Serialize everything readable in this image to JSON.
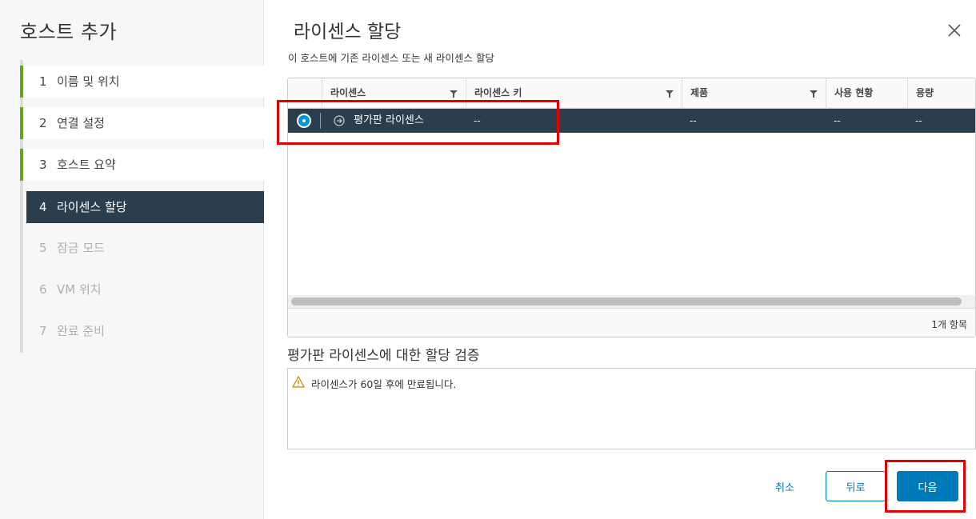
{
  "wizard": {
    "title": "호스트 추가",
    "steps": [
      {
        "num": "1",
        "label": "이름 및 위치",
        "state": "done"
      },
      {
        "num": "2",
        "label": "연결 설정",
        "state": "done"
      },
      {
        "num": "3",
        "label": "호스트 요약",
        "state": "done"
      },
      {
        "num": "4",
        "label": "라이센스 할당",
        "state": "active"
      },
      {
        "num": "5",
        "label": "잠금 모드",
        "state": "pending"
      },
      {
        "num": "6",
        "label": "VM 위치",
        "state": "pending"
      },
      {
        "num": "7",
        "label": "완료 준비",
        "state": "pending"
      }
    ]
  },
  "page": {
    "title": "라이센스 할당",
    "subtitle": "이 호스트에 기존 라이센스 또는 새 라이센스 할당"
  },
  "grid": {
    "columns": [
      "라이센스",
      "라이센스 키",
      "제품",
      "사용 현황",
      "용량"
    ],
    "rows": [
      {
        "license": "평가판 라이센스",
        "key": "--",
        "product": "--",
        "usage": "--",
        "capacity": "--",
        "selected": true
      }
    ],
    "footer_count": "1개 항목"
  },
  "validation": {
    "title": "평가판 라이센스에 대한 할당 검증",
    "message": "라이센스가 60일 후에 만료됩니다."
  },
  "buttons": {
    "cancel": "취소",
    "back": "뒤로",
    "next": "다음"
  },
  "colors": {
    "accent": "#0079b8",
    "selected_row": "#2b3e4d",
    "done_step": "#62a420",
    "annotation": "#e00000"
  },
  "icons": {
    "close": "close-icon",
    "filter": "filter-icon",
    "expand": "expand-arrow-icon",
    "warning": "warning-icon"
  }
}
